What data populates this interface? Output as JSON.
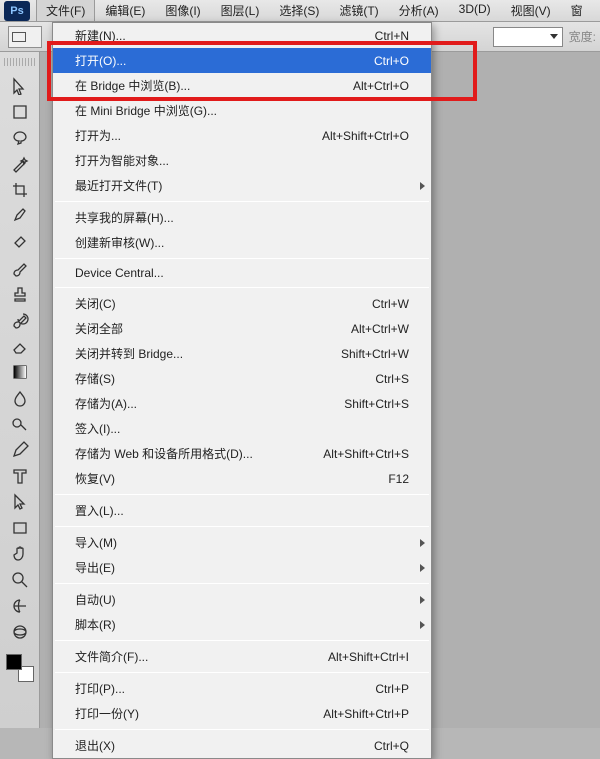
{
  "app": {
    "logo_text": "Ps"
  },
  "menubar": {
    "items": [
      "文件(F)",
      "编辑(E)",
      "图像(I)",
      "图层(L)",
      "选择(S)",
      "滤镜(T)",
      "分析(A)",
      "3D(D)",
      "视图(V)",
      "窗"
    ]
  },
  "optionsbar": {
    "width_label": "宽度:"
  },
  "toolbox": {
    "tools": [
      "move",
      "marquee",
      "lasso",
      "wand",
      "crop",
      "eyedropper",
      "healing",
      "brush",
      "stamp",
      "history-brush",
      "eraser",
      "gradient",
      "blur",
      "dodge",
      "pen",
      "type",
      "path-select",
      "rectangle",
      "hand",
      "zoom",
      "3d-rotate",
      "3d-orbit"
    ]
  },
  "file_menu": {
    "groups": [
      [
        {
          "label": "新建(N)...",
          "shortcut": "Ctrl+N"
        },
        {
          "label": "打开(O)...",
          "shortcut": "Ctrl+O",
          "highlighted": true
        },
        {
          "label": "在 Bridge 中浏览(B)...",
          "shortcut": "Alt+Ctrl+O"
        },
        {
          "label": "在 Mini Bridge 中浏览(G)..."
        },
        {
          "label": "打开为...",
          "shortcut": "Alt+Shift+Ctrl+O"
        },
        {
          "label": "打开为智能对象..."
        },
        {
          "label": "最近打开文件(T)",
          "submenu": true
        }
      ],
      [
        {
          "label": "共享我的屏幕(H)..."
        },
        {
          "label": "创建新审核(W)..."
        }
      ],
      [
        {
          "label": "Device Central..."
        }
      ],
      [
        {
          "label": "关闭(C)",
          "shortcut": "Ctrl+W"
        },
        {
          "label": "关闭全部",
          "shortcut": "Alt+Ctrl+W"
        },
        {
          "label": "关闭并转到 Bridge...",
          "shortcut": "Shift+Ctrl+W"
        },
        {
          "label": "存储(S)",
          "shortcut": "Ctrl+S"
        },
        {
          "label": "存储为(A)...",
          "shortcut": "Shift+Ctrl+S"
        },
        {
          "label": "签入(I)..."
        },
        {
          "label": "存储为 Web 和设备所用格式(D)...",
          "shortcut": "Alt+Shift+Ctrl+S"
        },
        {
          "label": "恢复(V)",
          "shortcut": "F12"
        }
      ],
      [
        {
          "label": "置入(L)..."
        }
      ],
      [
        {
          "label": "导入(M)",
          "submenu": true
        },
        {
          "label": "导出(E)",
          "submenu": true
        }
      ],
      [
        {
          "label": "自动(U)",
          "submenu": true
        },
        {
          "label": "脚本(R)",
          "submenu": true
        }
      ],
      [
        {
          "label": "文件简介(F)...",
          "shortcut": "Alt+Shift+Ctrl+I"
        }
      ],
      [
        {
          "label": "打印(P)...",
          "shortcut": "Ctrl+P"
        },
        {
          "label": "打印一份(Y)",
          "shortcut": "Alt+Shift+Ctrl+P"
        }
      ],
      [
        {
          "label": "退出(X)",
          "shortcut": "Ctrl+Q"
        }
      ]
    ]
  }
}
